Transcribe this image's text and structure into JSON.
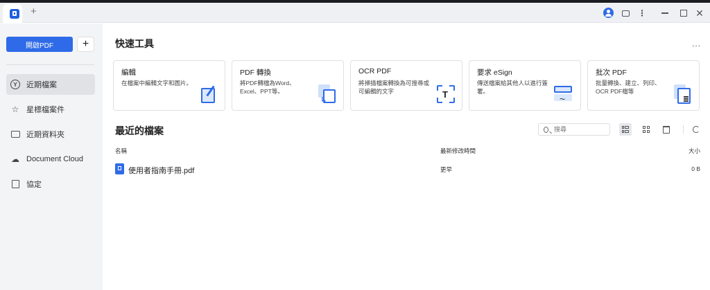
{
  "titlebar": {
    "new_tab_glyph": "+",
    "icons": [
      "app-logo-icon",
      "account-icon",
      "feedback-icon",
      "more-vertical-icon",
      "minimize-icon",
      "maximize-icon",
      "close-icon"
    ]
  },
  "sidebar": {
    "open_button": "開啟PDF",
    "add_button": "+",
    "items": [
      {
        "label": "近期檔案",
        "icon": "clock-icon",
        "active": true
      },
      {
        "label": "星標檔案件",
        "icon": "star-icon",
        "active": false
      },
      {
        "label": "近期資料夾",
        "icon": "folder-icon",
        "active": false
      },
      {
        "label": "Document Cloud",
        "icon": "cloud-icon",
        "active": false
      },
      {
        "label": "協定",
        "icon": "document-icon",
        "active": false
      }
    ]
  },
  "quick_tools": {
    "title": "快速工具",
    "more": "...",
    "cards": [
      {
        "title": "編輯",
        "desc": "在檔案中編輯文字和圖片。",
        "icon": "edit-icon"
      },
      {
        "title": "PDF 轉換",
        "desc": "將PDF轉檔為Word、Excel、PPT等。",
        "icon": "convert-icon"
      },
      {
        "title": "OCR PDF",
        "desc": "將掃描檔案轉換為可搜尋或可編輯的文字",
        "icon": "ocr-icon"
      },
      {
        "title": "要求 eSign",
        "desc": "傳送檔案給其他人以進行簽署。",
        "icon": "esign-icon"
      },
      {
        "title": "批次 PDF",
        "desc": "批量轉換、建立、列印、OCR PDF檔等",
        "icon": "batch-icon"
      }
    ]
  },
  "recent": {
    "title": "最近的檔案",
    "search_placeholder": "搜尋",
    "columns": {
      "name": "名稱",
      "modified": "最新修改時間",
      "size": "大小"
    },
    "files": [
      {
        "name": "使用者指南手冊.pdf",
        "modified": "更早",
        "size": "0 B"
      }
    ]
  },
  "colors": {
    "accent": "#2f6be8",
    "sidebar_bg": "#f3f4f6",
    "titlebar_bg": "#eef0f4"
  }
}
